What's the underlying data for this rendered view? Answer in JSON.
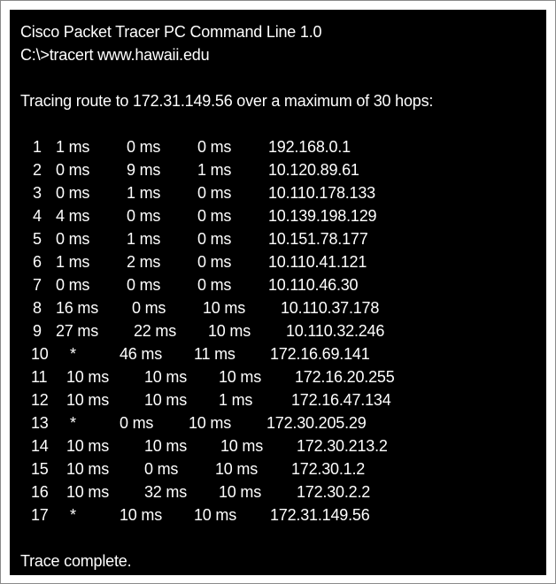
{
  "header": {
    "title": "Cisco Packet Tracer PC Command Line 1.0",
    "command": "C:\\>tracert www.hawaii.edu"
  },
  "tracing_line": "Tracing route to 172.31.149.56 over a maximum of 30 hops:",
  "hops": [
    {
      "hop": "1",
      "t1": "1 ms",
      "t2": "0 ms",
      "t3": "0 ms",
      "address": "192.168.0.1"
    },
    {
      "hop": "2",
      "t1": "0 ms",
      "t2": "9 ms",
      "t3": "1 ms",
      "address": "10.120.89.61"
    },
    {
      "hop": "3",
      "t1": "0 ms",
      "t2": "1 ms",
      "t3": "0 ms",
      "address": "10.110.178.133"
    },
    {
      "hop": "4",
      "t1": "4 ms",
      "t2": "0 ms",
      "t3": "0 ms",
      "address": "10.139.198.129"
    },
    {
      "hop": "5",
      "t1": "0 ms",
      "t2": "1 ms",
      "t3": "0 ms",
      "address": "10.151.78.177"
    },
    {
      "hop": "6",
      "t1": "1 ms",
      "t2": "2 ms",
      "t3": "0 ms",
      "address": "10.110.41.121"
    },
    {
      "hop": "7",
      "t1": "0 ms",
      "t2": "0 ms",
      "t3": "0 ms",
      "address": "10.110.46.30"
    },
    {
      "hop": "8",
      "t1": "16 ms",
      "t2": "0 ms",
      "t3": "10 ms",
      "address": "10.110.37.178"
    },
    {
      "hop": "9",
      "t1": "27 ms",
      "t2": "22 ms",
      "t3": "10 ms",
      "address": "10.110.32.246"
    },
    {
      "hop": "10",
      "t1": "*",
      "t2": "46 ms",
      "t3": "11 ms",
      "address": "172.16.69.141"
    },
    {
      "hop": "11",
      "t1": "10 ms",
      "t2": "10 ms",
      "t3": "10 ms",
      "address": "172.16.20.255"
    },
    {
      "hop": "12",
      "t1": "10 ms",
      "t2": "10 ms",
      "t3": "1 ms",
      "address": "172.16.47.134"
    },
    {
      "hop": "13",
      "t1": "*",
      "t2": "0 ms",
      "t3": "10 ms",
      "address": "172.30.205.29"
    },
    {
      "hop": "14",
      "t1": "10 ms",
      "t2": "10 ms",
      "t3": "10 ms",
      "address": "172.30.213.2"
    },
    {
      "hop": "15",
      "t1": "10 ms",
      "t2": "0 ms",
      "t3": "10 ms",
      "address": "172.30.1.2"
    },
    {
      "hop": "16",
      "t1": "10 ms",
      "t2": "32 ms",
      "t3": "10 ms",
      "address": "172.30.2.2"
    },
    {
      "hop": "17",
      "t1": "*",
      "t2": "10 ms",
      "t3": "10 ms",
      "address": "172.31.149.56"
    }
  ],
  "footer": "Trace complete.",
  "colors": {
    "background": "#000000",
    "text": "#ffffff",
    "frame": "#ffffff"
  }
}
